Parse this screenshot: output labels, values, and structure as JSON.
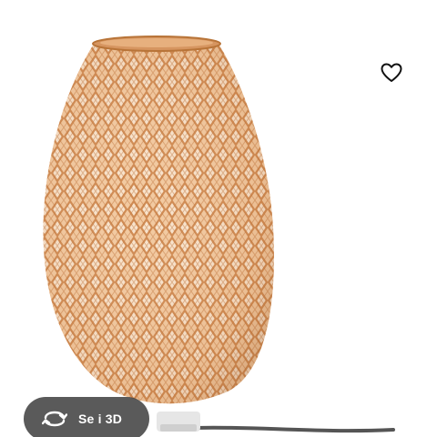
{
  "product": {
    "image_alt": "bamboo-table-lamp"
  },
  "actions": {
    "favorite_icon": "heart-outline-icon",
    "view_3d_label": "Se i 3D",
    "view_3d_icon": "rotate-360-icon"
  },
  "colors": {
    "shade_base": "#e9b27e",
    "shade_weave": "#c77f47",
    "pill_bg": "#484848",
    "pill_text": "#ffffff",
    "heart": "#111111"
  }
}
